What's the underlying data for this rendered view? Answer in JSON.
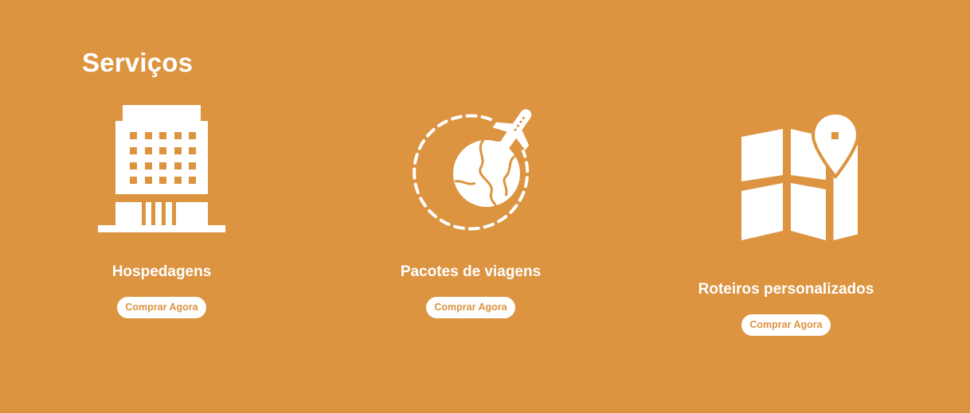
{
  "section": {
    "title": "Serviços"
  },
  "colors": {
    "background": "#dc9441",
    "foreground": "#ffffff",
    "button_text": "#dc9441"
  },
  "services": [
    {
      "icon": "hotel-building-icon",
      "title": "Hospedagens",
      "button_label": "Comprar Agora"
    },
    {
      "icon": "globe-airplane-icon",
      "title": "Pacotes de viagens",
      "button_label": "Comprar Agora"
    },
    {
      "icon": "map-pin-icon",
      "title": "Roteiros personalizados",
      "button_label": "Comprar Agora"
    }
  ]
}
